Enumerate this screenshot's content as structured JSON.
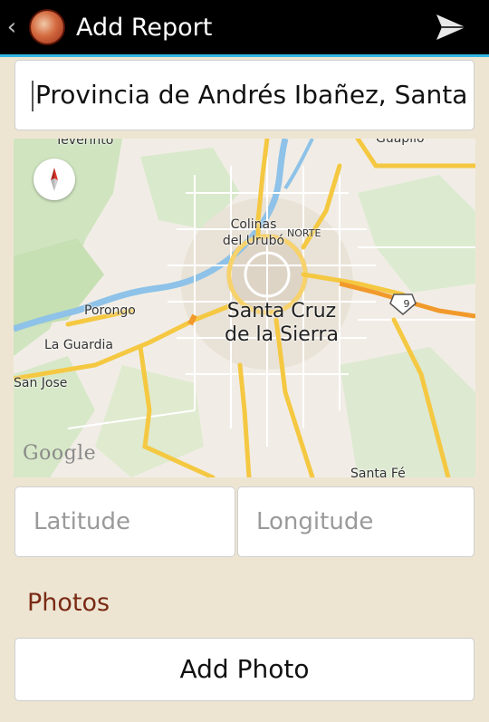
{
  "actionbar": {
    "back_glyph": "‹",
    "title": "Add Report",
    "logo_icon": "app-logo-icon",
    "send_icon": "send-icon"
  },
  "address": {
    "value": "Provincia de Andrés Ibañez, Santa C"
  },
  "map": {
    "labels": {
      "teverinto": "Teverinto",
      "colinas": "Colinas\ndel Urubó",
      "norte": "NORTE",
      "porongo": "Porongo",
      "santa_cruz": "Santa Cruz\nde la Sierra",
      "la_guardia": "La Guardia",
      "san_jose": "San Jose",
      "route": "9",
      "santa_fe": "Santa Fé",
      "top_right": "Guapilo"
    },
    "attribution": "Google",
    "compass_icon": "compass-icon"
  },
  "latitude": {
    "placeholder": "Latitude",
    "value": ""
  },
  "longitude": {
    "placeholder": "Longitude",
    "value": ""
  },
  "photos": {
    "heading": "Photos",
    "add_label": "Add Photo"
  },
  "colors": {
    "actionbar": "#000000",
    "accent_line": "#33b5e5",
    "background": "#ede5d2",
    "section_heading": "#7a2a14"
  }
}
